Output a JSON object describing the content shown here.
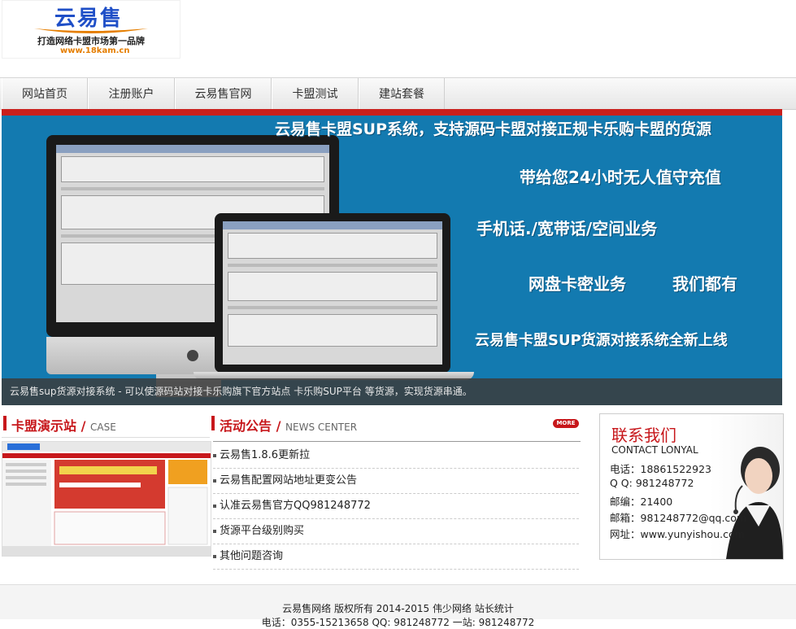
{
  "logo": {
    "brand": "云易售",
    "tagline": "打造网络卡盟市场第一品牌",
    "url": "www.18kam.cn"
  },
  "nav": {
    "items": [
      {
        "label": "网站首页"
      },
      {
        "label": "注册账户"
      },
      {
        "label": "云易售官网"
      },
      {
        "label": "卡盟测试"
      },
      {
        "label": "建站套餐"
      }
    ]
  },
  "banner": {
    "headline": "云易售卡盟SUP系统，支持源码卡盟对接正规卡乐购卡盟的货源",
    "line1": "带给您24小时无人值守充值",
    "line2": "手机话./宽带话/空间业务",
    "line3a": "网盘卡密业务",
    "line3b": "我们都有",
    "line4": "云易售卡盟SUP货源对接系统全新上线",
    "caption": "云易售sup货源对接系统 - 可以使源码站对接卡乐购旗下官方站点 卡乐购SUP平台 等货源，实现货源串通。",
    "colors": {
      "background": "#137ab0",
      "stripe": "#c9201d"
    }
  },
  "case_section": {
    "title": "卡盟演示站",
    "slash": "/",
    "subtitle": "CASE"
  },
  "news_section": {
    "title": "活动公告",
    "slash": "/",
    "subtitle": "NEWS CENTER",
    "more_label": "MORE",
    "items": [
      {
        "title": "云易售1.8.6更新拉"
      },
      {
        "title": "云易售配置网站地址更变公告"
      },
      {
        "title": "认准云易售官方QQ981248772"
      },
      {
        "title": "货源平台级别购买"
      },
      {
        "title": "其他问题咨询"
      }
    ]
  },
  "contact": {
    "title": "联系我们",
    "subtitle": "CONTACT LONYAL",
    "phone": "电话：18861522923",
    "qq": "Q Q:  981248772",
    "postcode": "邮编：21400",
    "email": "邮箱：981248772@qq.com",
    "website": "网址：www.yunyishou.com"
  },
  "footer": {
    "copyright": "云易售网络 版权所有 2014-2015 伟少网络 站长统计",
    "line2": "电话：0355-15213658 QQ: 981248772 一站: 981248772"
  },
  "colors": {
    "accent": "#c7171b"
  }
}
